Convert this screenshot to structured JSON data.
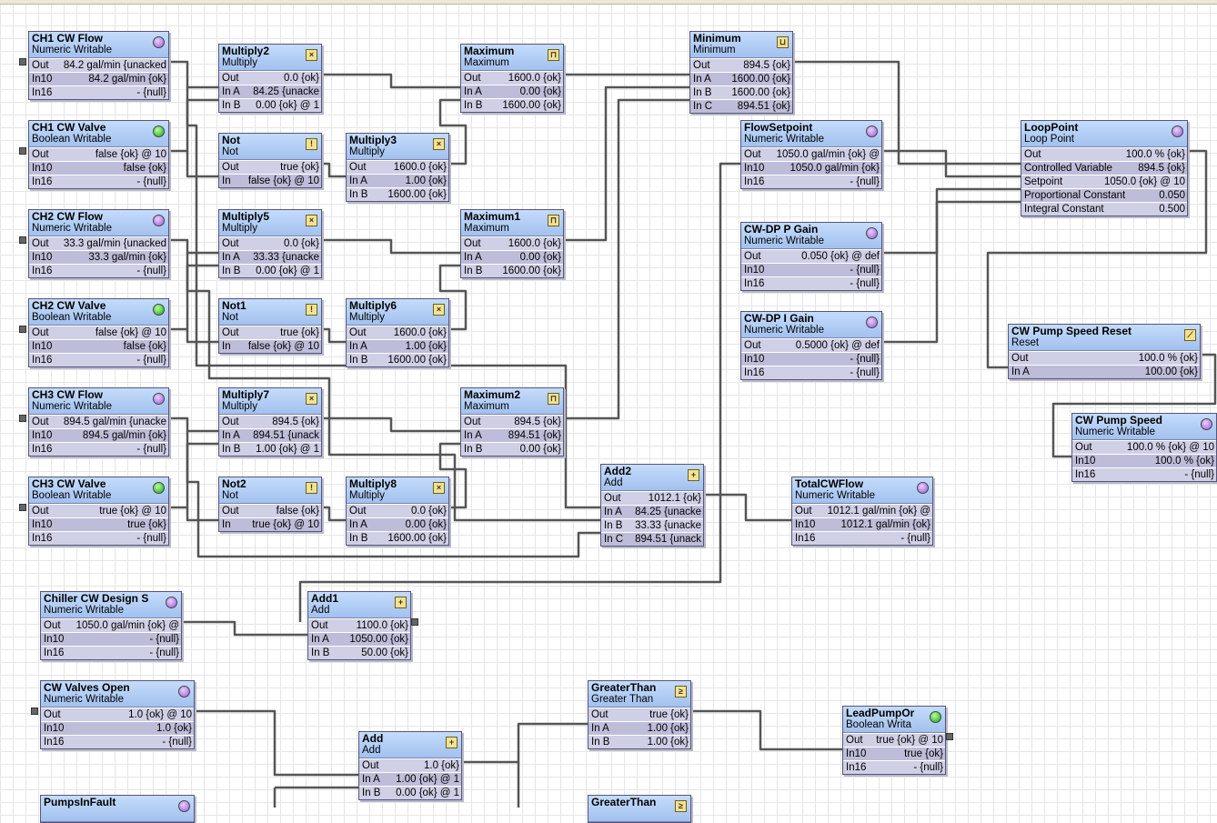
{
  "blocks": [
    {
      "id": "ch1-cw-flow",
      "title": "CH1 CW Flow",
      "subtitle": "Numeric Writable",
      "icon": "purple-dot-icon",
      "slots": [
        {
          "name": "Out",
          "value": "84.2 gal/min {unacked"
        },
        {
          "name": "In10",
          "value": "84.2 gal/min {ok}"
        },
        {
          "name": "In16",
          "value": "- {null}"
        }
      ]
    },
    {
      "id": "ch1-cw-valve",
      "title": "CH1 CW Valve",
      "subtitle": "Boolean Writable",
      "icon": "green-dot-icon",
      "slots": [
        {
          "name": "Out",
          "value": "false {ok} @ 10"
        },
        {
          "name": "In10",
          "value": "false {ok}"
        },
        {
          "name": "In16",
          "value": "- {null}"
        }
      ]
    },
    {
      "id": "ch2-cw-flow",
      "title": "CH2 CW Flow",
      "subtitle": "Numeric Writable",
      "icon": "purple-dot-icon",
      "slots": [
        {
          "name": "Out",
          "value": "33.3 gal/min {unacked"
        },
        {
          "name": "In10",
          "value": "33.3 gal/min {ok}"
        },
        {
          "name": "In16",
          "value": "- {null}"
        }
      ]
    },
    {
      "id": "ch2-cw-valve",
      "title": "CH2 CW Valve",
      "subtitle": "Boolean Writable",
      "icon": "green-dot-icon",
      "slots": [
        {
          "name": "Out",
          "value": "false {ok} @ 10"
        },
        {
          "name": "In10",
          "value": "false {ok}"
        },
        {
          "name": "In16",
          "value": "- {null}"
        }
      ]
    },
    {
      "id": "ch3-cw-flow",
      "title": "CH3 CW Flow",
      "subtitle": "Numeric Writable",
      "icon": "purple-dot-icon",
      "slots": [
        {
          "name": "Out",
          "value": "894.5 gal/min {unacke"
        },
        {
          "name": "In10",
          "value": "894.5 gal/min {ok}"
        },
        {
          "name": "In16",
          "value": "- {null}"
        }
      ]
    },
    {
      "id": "ch3-cw-valve",
      "title": "CH3 CW Valve",
      "subtitle": "Boolean Writable",
      "icon": "green-dot-icon",
      "slots": [
        {
          "name": "Out",
          "value": "true {ok} @ 10"
        },
        {
          "name": "In10",
          "value": "true {ok}"
        },
        {
          "name": "In16",
          "value": "- {null}"
        }
      ]
    },
    {
      "id": "multiply2",
      "title": "Multiply2",
      "subtitle": "Multiply",
      "icon": "multiply-icon",
      "glyph": "×",
      "slots": [
        {
          "name": "Out",
          "value": "0.0 {ok}"
        },
        {
          "name": "In A",
          "value": "84.25 {unacke"
        },
        {
          "name": "In B",
          "value": "0.00 {ok} @ 1"
        }
      ]
    },
    {
      "id": "not",
      "title": "Not",
      "subtitle": "Not",
      "icon": "not-icon",
      "glyph": "!",
      "slots": [
        {
          "name": "Out",
          "value": "true {ok}"
        },
        {
          "name": "In",
          "value": "false {ok} @ 10"
        }
      ]
    },
    {
      "id": "multiply5",
      "title": "Multiply5",
      "subtitle": "Multiply",
      "icon": "multiply-icon",
      "glyph": "×",
      "slots": [
        {
          "name": "Out",
          "value": "0.0 {ok}"
        },
        {
          "name": "In A",
          "value": "33.33 {unacke"
        },
        {
          "name": "In B",
          "value": "0.00 {ok} @ 1"
        }
      ]
    },
    {
      "id": "not1",
      "title": "Not1",
      "subtitle": "Not",
      "icon": "not-icon",
      "glyph": "!",
      "slots": [
        {
          "name": "Out",
          "value": "true {ok}"
        },
        {
          "name": "In",
          "value": "false {ok} @ 10"
        }
      ]
    },
    {
      "id": "multiply7",
      "title": "Multiply7",
      "subtitle": "Multiply",
      "icon": "multiply-icon",
      "glyph": "×",
      "slots": [
        {
          "name": "Out",
          "value": "894.5 {ok}"
        },
        {
          "name": "In A",
          "value": "894.51 {unack"
        },
        {
          "name": "In B",
          "value": "1.00 {ok} @ 1"
        }
      ]
    },
    {
      "id": "not2",
      "title": "Not2",
      "subtitle": "Not",
      "icon": "not-icon",
      "glyph": "!",
      "slots": [
        {
          "name": "Out",
          "value": "false {ok}"
        },
        {
          "name": "In",
          "value": "true {ok} @ 10"
        }
      ]
    },
    {
      "id": "multiply3",
      "title": "Multiply3",
      "subtitle": "Multiply",
      "icon": "multiply-icon",
      "glyph": "×",
      "slots": [
        {
          "name": "Out",
          "value": "1600.0 {ok}"
        },
        {
          "name": "In A",
          "value": "1.00 {ok}"
        },
        {
          "name": "In B",
          "value": "1600.00 {ok}"
        }
      ]
    },
    {
      "id": "multiply6",
      "title": "Multiply6",
      "subtitle": "Multiply",
      "icon": "multiply-icon",
      "glyph": "×",
      "slots": [
        {
          "name": "Out",
          "value": "1600.0 {ok}"
        },
        {
          "name": "In A",
          "value": "1.00 {ok}"
        },
        {
          "name": "In B",
          "value": "1600.00 {ok}"
        }
      ]
    },
    {
      "id": "multiply8",
      "title": "Multiply8",
      "subtitle": "Multiply",
      "icon": "multiply-icon",
      "glyph": "×",
      "slots": [
        {
          "name": "Out",
          "value": "0.0 {ok}"
        },
        {
          "name": "In A",
          "value": "0.00 {ok}"
        },
        {
          "name": "In B",
          "value": "1600.00 {ok}"
        }
      ]
    },
    {
      "id": "maximum",
      "title": "Maximum",
      "subtitle": "Maximum",
      "icon": "maximum-icon",
      "glyph": "⊓",
      "slots": [
        {
          "name": "Out",
          "value": "1600.0 {ok}"
        },
        {
          "name": "In A",
          "value": "0.00 {ok}"
        },
        {
          "name": "In B",
          "value": "1600.00 {ok}"
        }
      ]
    },
    {
      "id": "maximum1",
      "title": "Maximum1",
      "subtitle": "Maximum",
      "icon": "maximum-icon",
      "glyph": "⊓",
      "slots": [
        {
          "name": "Out",
          "value": "1600.0 {ok}"
        },
        {
          "name": "In A",
          "value": "0.00 {ok}"
        },
        {
          "name": "In B",
          "value": "1600.00 {ok}"
        }
      ]
    },
    {
      "id": "maximum2",
      "title": "Maximum2",
      "subtitle": "Maximum",
      "icon": "maximum-icon",
      "glyph": "⊓",
      "slots": [
        {
          "name": "Out",
          "value": "894.5 {ok}"
        },
        {
          "name": "In A",
          "value": "894.51 {ok}"
        },
        {
          "name": "In B",
          "value": "0.00 {ok}"
        }
      ]
    },
    {
      "id": "minimum",
      "title": "Minimum",
      "subtitle": "Minimum",
      "icon": "minimum-icon",
      "glyph": "⊔",
      "slots": [
        {
          "name": "Out",
          "value": "894.5 {ok}"
        },
        {
          "name": "In A",
          "value": "1600.00 {ok}"
        },
        {
          "name": "In B",
          "value": "1600.00 {ok}"
        },
        {
          "name": "In C",
          "value": "894.51 {ok}"
        }
      ]
    },
    {
      "id": "add2",
      "title": "Add2",
      "subtitle": "Add",
      "icon": "add-icon",
      "glyph": "+",
      "slots": [
        {
          "name": "Out",
          "value": "1012.1 {ok}"
        },
        {
          "name": "In A",
          "value": "84.25 {unacke"
        },
        {
          "name": "In B",
          "value": "33.33 {unacke"
        },
        {
          "name": "In C",
          "value": "894.51 {unack"
        }
      ]
    },
    {
      "id": "flowsetpoint",
      "title": "FlowSetpoint",
      "subtitle": "Numeric Writable",
      "icon": "purple-dot-icon",
      "slots": [
        {
          "name": "Out",
          "value": "1050.0 gal/min {ok} @"
        },
        {
          "name": "In10",
          "value": "1050.0 gal/min {ok}"
        },
        {
          "name": "In16",
          "value": "- {null}"
        }
      ]
    },
    {
      "id": "cw-dp-p-gain",
      "title": "CW-DP P Gain",
      "subtitle": "Numeric Writable",
      "icon": "purple-dot-icon",
      "slots": [
        {
          "name": "Out",
          "value": "0.050 {ok} @ def"
        },
        {
          "name": "In10",
          "value": "- {null}"
        },
        {
          "name": "In16",
          "value": "- {null}"
        }
      ]
    },
    {
      "id": "cw-dp-i-gain",
      "title": "CW-DP I Gain",
      "subtitle": "Numeric Writable",
      "icon": "purple-dot-icon",
      "slots": [
        {
          "name": "Out",
          "value": "0.5000 {ok} @ def"
        },
        {
          "name": "In10",
          "value": "- {null}"
        },
        {
          "name": "In16",
          "value": "- {null}"
        }
      ]
    },
    {
      "id": "totalcwflow",
      "title": "TotalCWFlow",
      "subtitle": "Numeric Writable",
      "icon": "purple-dot-icon",
      "slots": [
        {
          "name": "Out",
          "value": "1012.1 gal/min {ok} @"
        },
        {
          "name": "In10",
          "value": "1012.1 gal/min {ok}"
        },
        {
          "name": "In16",
          "value": "- {null}"
        }
      ]
    },
    {
      "id": "looppoint",
      "title": "LoopPoint",
      "subtitle": "Loop Point",
      "icon": "purple-dot-icon",
      "slots": [
        {
          "name": "Out",
          "value": "100.0 % {ok}"
        },
        {
          "name": "Controlled Variable",
          "value": "894.5 {ok}"
        },
        {
          "name": "Setpoint",
          "value": "1050.0 {ok} @ 10"
        },
        {
          "name": "Proportional Constant",
          "value": "0.050"
        },
        {
          "name": "Integral Constant",
          "value": "0.500"
        }
      ]
    },
    {
      "id": "cw-pump-speed-reset",
      "title": "CW Pump Speed Reset",
      "subtitle": "Reset",
      "icon": "reset-icon",
      "glyph": "⟋",
      "slots": [
        {
          "name": "Out",
          "value": "100.0 % {ok}"
        },
        {
          "name": "In A",
          "value": "100.00 {ok}"
        }
      ]
    },
    {
      "id": "cw-pump-speed",
      "title": "CW Pump Speed",
      "subtitle": "Numeric Writable",
      "icon": "purple-dot-icon",
      "slots": [
        {
          "name": "Out",
          "value": "100.0 % {ok} @ 10"
        },
        {
          "name": "In10",
          "value": "100.0 % {ok}"
        },
        {
          "name": "In16",
          "value": "- {null}"
        }
      ]
    },
    {
      "id": "chiller-cw-design",
      "title": "Chiller CW Design S",
      "subtitle": "Numeric Writable",
      "icon": "purple-dot-icon",
      "slots": [
        {
          "name": "Out",
          "value": "1050.0 gal/min {ok} @"
        },
        {
          "name": "In10",
          "value": "- {null}"
        },
        {
          "name": "In16",
          "value": "- {null}"
        }
      ]
    },
    {
      "id": "add1",
      "title": "Add1",
      "subtitle": "Add",
      "icon": "add-icon",
      "glyph": "+",
      "slots": [
        {
          "name": "Out",
          "value": "1100.0 {ok}"
        },
        {
          "name": "In A",
          "value": "1050.00 {ok}"
        },
        {
          "name": "In B",
          "value": "50.00 {ok}"
        }
      ]
    },
    {
      "id": "cw-valves-open",
      "title": "CW Valves Open",
      "subtitle": "Numeric Writable",
      "icon": "purple-dot-icon",
      "slots": [
        {
          "name": "Out",
          "value": "1.0 {ok} @ 10"
        },
        {
          "name": "In10",
          "value": "1.0 {ok}"
        },
        {
          "name": "In16",
          "value": "- {null}"
        }
      ]
    },
    {
      "id": "add",
      "title": "Add",
      "subtitle": "Add",
      "icon": "add-icon",
      "glyph": "+",
      "slots": [
        {
          "name": "Out",
          "value": "1.0 {ok}"
        },
        {
          "name": "In A",
          "value": "1.00 {ok} @ 1"
        },
        {
          "name": "In B",
          "value": "0.00 {ok} @ 1"
        }
      ]
    },
    {
      "id": "greaterthan",
      "title": "GreaterThan",
      "subtitle": "Greater Than",
      "icon": "greater-than-icon",
      "glyph": "≥",
      "slots": [
        {
          "name": "Out",
          "value": "true {ok}"
        },
        {
          "name": "In A",
          "value": "1.00 {ok}"
        },
        {
          "name": "In B",
          "value": "1.00 {ok}"
        }
      ]
    },
    {
      "id": "leadpumpon",
      "title": "LeadPumpOr",
      "subtitle": "Boolean Writa",
      "icon": "green-dot-icon",
      "slots": [
        {
          "name": "Out",
          "value": "true {ok} @ 10"
        },
        {
          "name": "In10",
          "value": "true {ok}"
        },
        {
          "name": "In16",
          "value": "- {null}"
        }
      ]
    },
    {
      "id": "pumpsinfault",
      "title": "PumpsInFault",
      "subtitle": "",
      "icon": "purple-dot-icon",
      "slots": []
    },
    {
      "id": "greaterthan-2",
      "title": "GreaterThan",
      "subtitle": "",
      "icon": "greater-than-icon",
      "glyph": "≥",
      "slots": []
    }
  ]
}
